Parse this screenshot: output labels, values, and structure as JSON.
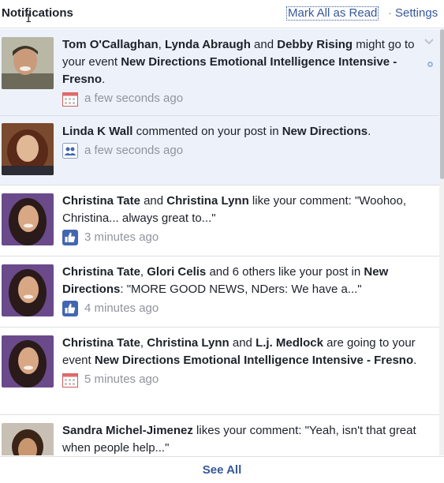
{
  "header": {
    "title": "Notifications",
    "mark_all_read": "Mark All as Read",
    "separator": "·",
    "settings": "Settings"
  },
  "notifications": [
    {
      "parts": [
        {
          "t": "Tom O'Callaghan",
          "b": true
        },
        {
          "t": ", ",
          "b": false
        },
        {
          "t": "Lynda Abraugh",
          "b": true
        },
        {
          "t": " and ",
          "b": false
        },
        {
          "t": "Debby Rising",
          "b": true
        },
        {
          "t": " might go to your event ",
          "b": false
        },
        {
          "t": "New Directions Emotional Intelligence Intensive - Fresno",
          "b": true
        },
        {
          "t": ".",
          "b": false
        }
      ],
      "icon": "calendar-icon",
      "time": "a few seconds ago",
      "unread": true
    },
    {
      "parts": [
        {
          "t": "Linda K Wall",
          "b": true
        },
        {
          "t": " commented on your post in ",
          "b": false
        },
        {
          "t": "New Directions",
          "b": true
        },
        {
          "t": ".",
          "b": false
        }
      ],
      "icon": "group-icon",
      "time": "a few seconds ago",
      "unread": true
    },
    {
      "parts": [
        {
          "t": "Christina Tate",
          "b": true
        },
        {
          "t": " and ",
          "b": false
        },
        {
          "t": "Christina Lynn",
          "b": true
        },
        {
          "t": " like your comment: \"Woohoo, Christina... always great to...\"",
          "b": false
        }
      ],
      "icon": "like-icon",
      "time": "3 minutes ago",
      "unread": false
    },
    {
      "parts": [
        {
          "t": "Christina Tate",
          "b": true
        },
        {
          "t": ", ",
          "b": false
        },
        {
          "t": "Glori Celis",
          "b": true
        },
        {
          "t": " and 6 others like your post in ",
          "b": false
        },
        {
          "t": "New Directions",
          "b": true
        },
        {
          "t": ": \"MORE GOOD NEWS, NDers: We have a...\"",
          "b": false
        }
      ],
      "icon": "like-icon",
      "time": "4 minutes ago",
      "unread": false
    },
    {
      "parts": [
        {
          "t": "Christina Tate",
          "b": true
        },
        {
          "t": ", ",
          "b": false
        },
        {
          "t": "Christina Lynn",
          "b": true
        },
        {
          "t": " and ",
          "b": false
        },
        {
          "t": "L.j. Medlock",
          "b": true
        },
        {
          "t": " are going to your event ",
          "b": false
        },
        {
          "t": "New Directions Emotional Intelligence Intensive - Fresno",
          "b": true
        },
        {
          "t": ".",
          "b": false
        }
      ],
      "icon": "calendar-icon",
      "time": "5 minutes ago",
      "unread": false
    },
    {
      "parts": [
        {
          "t": "Sandra Michel-Jimenez",
          "b": true
        },
        {
          "t": " likes your comment: \"Yeah, isn't that great when people help...\"",
          "b": false
        }
      ],
      "icon": "like-icon",
      "time": "",
      "unread": false
    }
  ],
  "footer": {
    "see_all": "See All"
  },
  "colors": {
    "link": "#365899",
    "unread_bg": "#edf2fa",
    "meta": "#90949c",
    "like_blue": "#4267b2"
  }
}
